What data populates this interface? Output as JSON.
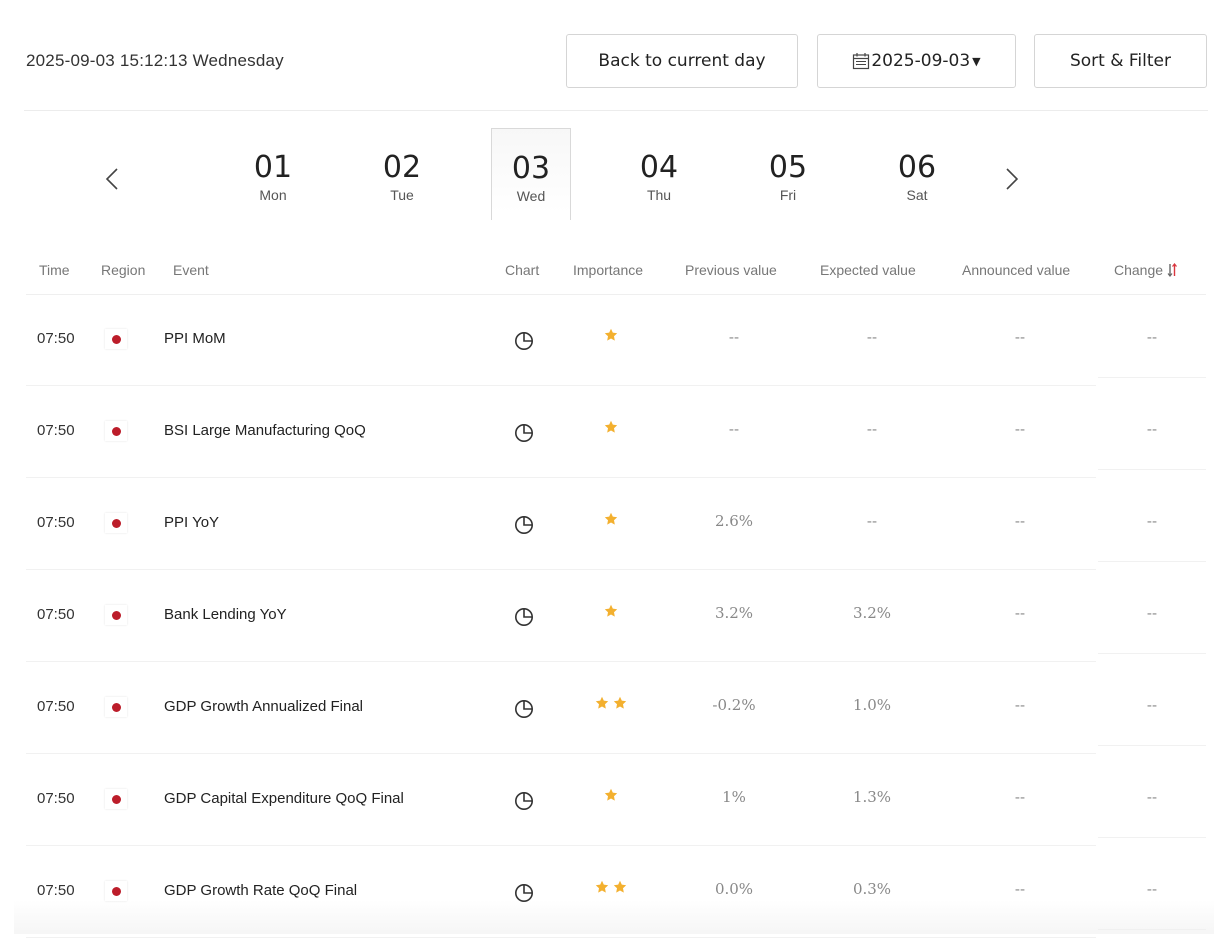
{
  "header": {
    "datetime": "2025-09-03 15:12:13 Wednesday",
    "back_button": "Back to current day",
    "date_picker": "2025-09-03",
    "sort_filter_button": "Sort & Filter"
  },
  "days": [
    {
      "num": "01",
      "name": "Mon"
    },
    {
      "num": "02",
      "name": "Tue"
    },
    {
      "num": "03",
      "name": "Wed",
      "active": true
    },
    {
      "num": "04",
      "name": "Thu"
    },
    {
      "num": "05",
      "name": "Fri"
    },
    {
      "num": "06",
      "name": "Sat"
    }
  ],
  "columns": {
    "time": "Time",
    "region": "Region",
    "event": "Event",
    "chart": "Chart",
    "importance": "Importance",
    "previous": "Previous value",
    "expected": "Expected value",
    "announced": "Announced value",
    "change": "Change"
  },
  "rows": [
    {
      "time": "07:50",
      "event": "PPI MoM",
      "stars": 1,
      "previous": "--",
      "expected": "--",
      "announced": "--",
      "change": "--"
    },
    {
      "time": "07:50",
      "event": "BSI Large Manufacturing QoQ",
      "stars": 1,
      "previous": "--",
      "expected": "--",
      "announced": "--",
      "change": "--"
    },
    {
      "time": "07:50",
      "event": "PPI YoY",
      "stars": 1,
      "previous": "2.6%",
      "expected": "--",
      "announced": "--",
      "change": "--"
    },
    {
      "time": "07:50",
      "event": "Bank Lending YoY",
      "stars": 1,
      "previous": "3.2%",
      "expected": "3.2%",
      "announced": "--",
      "change": "--"
    },
    {
      "time": "07:50",
      "event": "GDP Growth Annualized Final",
      "stars": 2,
      "previous": "-0.2%",
      "expected": "1.0%",
      "announced": "--",
      "change": "--"
    },
    {
      "time": "07:50",
      "event": "GDP Capital Expenditure QoQ Final",
      "stars": 1,
      "previous": "1%",
      "expected": "1.3%",
      "announced": "--",
      "change": "--"
    },
    {
      "time": "07:50",
      "event": "GDP Growth Rate QoQ Final",
      "stars": 2,
      "previous": "0.0%",
      "expected": "0.3%",
      "announced": "--",
      "change": "--"
    }
  ],
  "colors": {
    "star": "#f3b02f",
    "flag_dot": "#bc1d2a",
    "sort_up": "#d9363e",
    "sort_down": "#666666"
  },
  "icons": {
    "region_flag": "japan-flag-icon",
    "chart": "pie-chart-icon",
    "importance": "star-icon",
    "sort": "sort-arrows-icon",
    "calendar": "calendar-icon"
  }
}
